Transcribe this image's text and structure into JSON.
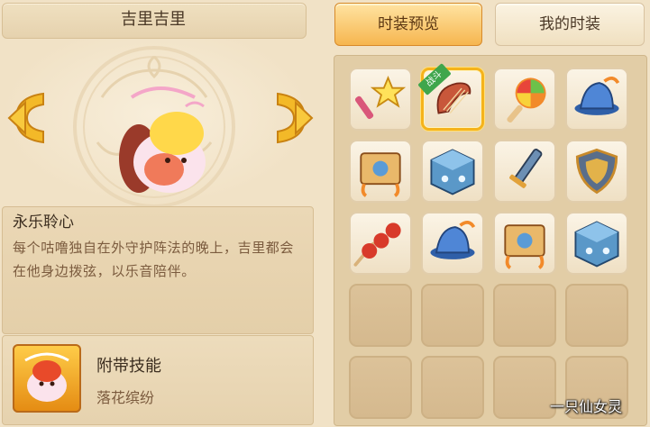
{
  "character": {
    "name": "吉里吉里"
  },
  "outfit": {
    "title": "永乐聆心",
    "description": "每个咕噜独自在外守护阵法的晚上，吉里都会在他身边拨弦，以乐音陪伴。"
  },
  "skill": {
    "heading": "附带技能",
    "name": "落花缤纷"
  },
  "tabs": [
    {
      "label": "时装预览",
      "active": true
    },
    {
      "label": "我的时装",
      "active": false
    }
  ],
  "grid": {
    "items": [
      {
        "icon": "star-wand-icon"
      },
      {
        "icon": "harp-icon",
        "selected": true,
        "badge": "战斗"
      },
      {
        "icon": "lollipop-icon"
      },
      {
        "icon": "hat-icon"
      },
      {
        "icon": "banner-scroll-icon"
      },
      {
        "icon": "dice-cube-icon"
      },
      {
        "icon": "sword-icon"
      },
      {
        "icon": "shield-icon"
      },
      {
        "icon": "candied-haw-icon"
      },
      {
        "icon": "hat-icon"
      },
      {
        "icon": "banner-scroll-icon"
      },
      {
        "icon": "dice-cube-icon"
      },
      {
        "icon": "empty"
      },
      {
        "icon": "empty"
      },
      {
        "icon": "empty"
      },
      {
        "icon": "empty"
      },
      {
        "icon": "empty"
      },
      {
        "icon": "empty"
      },
      {
        "icon": "empty"
      },
      {
        "icon": "empty"
      }
    ]
  },
  "watermark": "一只仙女灵",
  "colors": {
    "accent": "#f6b64f",
    "selected": "#f5b31b",
    "badge": "#3fa64c"
  }
}
